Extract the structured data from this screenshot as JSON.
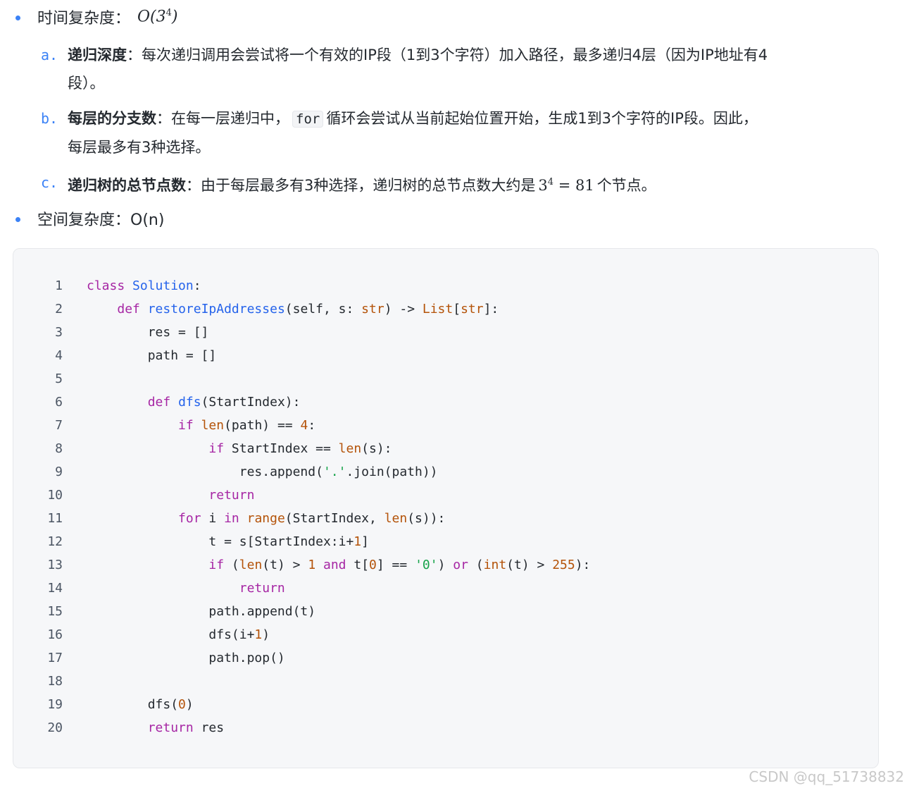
{
  "time_bullet": {
    "label": "时间复杂度：",
    "math_base": "O(3",
    "math_exp": "4",
    "math_close": ")"
  },
  "items": [
    {
      "marker": "a.",
      "bold": "递归深度",
      "text": "：每次递归调用会尝试将一个有效的IP段（1到3个字符）加入路径，最多递归4层（因为IP地址有4",
      "text2": "段）。"
    },
    {
      "marker": "b.",
      "bold": "每层的分支数",
      "text_pre": "：在每一层递归中，",
      "code": "for",
      "text_post": "循环会尝试从当前起始位置开始，生成1到3个字符的IP段。因此，",
      "text2": "每层最多有3种选择。"
    },
    {
      "marker": "c.",
      "bold": "递归树的总节点数",
      "text_pre": "：由于每层最多有3种选择，递归树的总节点数大约是",
      "math_base": "3",
      "math_exp": "4",
      "math_eq": " = 81",
      "text_post": "个节点。"
    }
  ],
  "space_bullet": {
    "label": "空间复杂度：O(n)"
  },
  "code_lines": [
    {
      "n": "1"
    },
    {
      "n": "2"
    },
    {
      "n": "3"
    },
    {
      "n": "4"
    },
    {
      "n": "5"
    },
    {
      "n": "6"
    },
    {
      "n": "7"
    },
    {
      "n": "8"
    },
    {
      "n": "9"
    },
    {
      "n": "10"
    },
    {
      "n": "11"
    },
    {
      "n": "12"
    },
    {
      "n": "13"
    },
    {
      "n": "14"
    },
    {
      "n": "15"
    },
    {
      "n": "16"
    },
    {
      "n": "17"
    },
    {
      "n": "18"
    },
    {
      "n": "19"
    },
    {
      "n": "20"
    }
  ],
  "code_tokens": {
    "l1": [
      "class",
      " ",
      "Solution",
      ":"
    ],
    "l2": [
      "    ",
      "def",
      " ",
      "restoreIpAddresses",
      "(self, s: ",
      "str",
      ") -> ",
      "List",
      "[",
      "str",
      "]:"
    ],
    "l3": [
      "        res = []"
    ],
    "l4": [
      "        path = []"
    ],
    "l5": [
      ""
    ],
    "l6": [
      "        ",
      "def",
      " ",
      "dfs",
      "(StartIndex):"
    ],
    "l7": [
      "            ",
      "if",
      " ",
      "len",
      "(path) == ",
      "4",
      ":"
    ],
    "l8": [
      "                ",
      "if",
      " StartIndex == ",
      "len",
      "(s):"
    ],
    "l9": [
      "                    res.append(",
      "'.'",
      ".join(path))"
    ],
    "l10": [
      "                ",
      "return"
    ],
    "l11": [
      "            ",
      "for",
      " i ",
      "in",
      " ",
      "range",
      "(StartIndex, ",
      "len",
      "(s)):"
    ],
    "l12": [
      "                t = s[StartIndex:i+",
      "1",
      "]"
    ],
    "l13": [
      "                ",
      "if",
      " (",
      "len",
      "(t) > ",
      "1",
      " ",
      "and",
      " t[",
      "0",
      "] == ",
      "'0'",
      ") ",
      "or",
      " (",
      "int",
      "(t) > ",
      "255",
      "):"
    ],
    "l14": [
      "                    ",
      "return"
    ],
    "l15": [
      "                path.append(t)"
    ],
    "l16": [
      "                dfs(i+",
      "1",
      ")"
    ],
    "l17": [
      "                path.pop()"
    ],
    "l18": [
      ""
    ],
    "l19": [
      "        dfs(",
      "0",
      ")"
    ],
    "l20": [
      "        ",
      "return",
      " res"
    ]
  },
  "watermark": "CSDN @qq_51738832",
  "colors": {
    "accent": "#3b82f6",
    "keyword": "#a626a4",
    "function": "#2563eb",
    "builtin": "#b45309",
    "string": "#16a34a"
  }
}
